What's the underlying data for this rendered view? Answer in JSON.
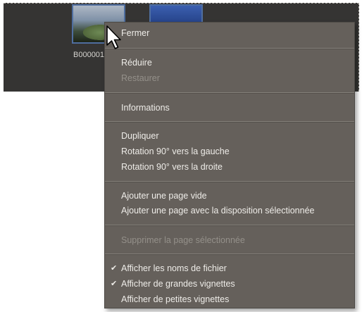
{
  "thumbnail_bin": {
    "thumbnails": [
      {
        "caption": "B000001"
      },
      {
        "caption": ""
      }
    ]
  },
  "context_menu": {
    "groups": [
      {
        "items": [
          {
            "label": "Fermer",
            "enabled": true
          }
        ]
      },
      {
        "items": [
          {
            "label": "Réduire",
            "enabled": true
          },
          {
            "label": "Restaurer",
            "enabled": false
          }
        ]
      },
      {
        "items": [
          {
            "label": "Informations",
            "enabled": true
          }
        ]
      },
      {
        "items": [
          {
            "label": "Dupliquer",
            "enabled": true
          },
          {
            "label": "Rotation 90° vers la gauche",
            "enabled": true
          },
          {
            "label": "Rotation 90° vers la droite",
            "enabled": true
          }
        ]
      },
      {
        "items": [
          {
            "label": "Ajouter une page vide",
            "enabled": true
          },
          {
            "label": "Ajouter une page avec la disposition sélectionnée",
            "enabled": true
          }
        ]
      },
      {
        "items": [
          {
            "label": "Supprimer la page sélectionnée",
            "enabled": false
          }
        ]
      },
      {
        "items": [
          {
            "label": "Afficher les noms de fichier",
            "enabled": true,
            "checked": true
          },
          {
            "label": "Afficher de grandes vignettes",
            "enabled": true,
            "checked": true
          },
          {
            "label": "Afficher de petites vignettes",
            "enabled": true,
            "checked": false
          }
        ]
      }
    ]
  },
  "icons": {
    "checkmark": "checkmark-icon",
    "cursor": "arrow-cursor-icon"
  },
  "colors": {
    "menu_background": "#65605b",
    "menu_text": "#eeece8",
    "disabled_text": "#94908a",
    "bin_background": "#353433",
    "thumbnail_selection": "#4f6e9f"
  }
}
